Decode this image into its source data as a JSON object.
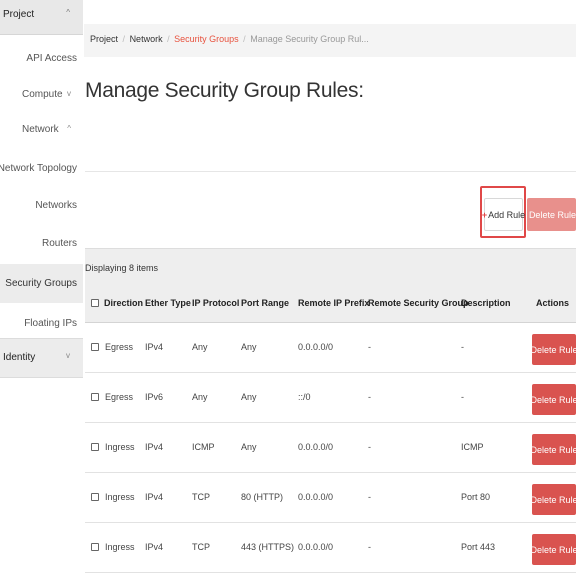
{
  "sidebar": {
    "project": {
      "label": "Project",
      "chevron": "^"
    },
    "api_access": "API Access",
    "compute": {
      "label": "Compute",
      "chevron": "v"
    },
    "network": {
      "label": "Network",
      "chevron": "^"
    },
    "network_topology": "Network Topology",
    "networks": "Networks",
    "routers": "Routers",
    "security_groups": "Security Groups",
    "floating_ips": "Floating IPs",
    "identity": {
      "label": "Identity",
      "chevron": "v"
    }
  },
  "breadcrumb": {
    "items": [
      "Project",
      "Network",
      "Security Groups",
      "Manage Security Group Rul..."
    ],
    "separator": "/"
  },
  "page_title": "Manage Security Group Rules:",
  "toolbar": {
    "add_rule_label": "Add Rule",
    "add_rule_icon": "plus-icon",
    "delete_rules_label": "Delete Rules",
    "delete_rules_icon": "trash-icon"
  },
  "table": {
    "caption": "Displaying 8 items",
    "columns": [
      "Direction",
      "Ether Type",
      "IP Protocol",
      "Port Range",
      "Remote IP Prefix",
      "Remote Security Group",
      "Description",
      "Actions"
    ],
    "rows": [
      {
        "direction": "Egress",
        "ether_type": "IPv4",
        "ip_protocol": "Any",
        "port_range": "Any",
        "remote_ip_prefix": "0.0.0.0/0",
        "remote_security_group": "-",
        "description": "-",
        "action": "Delete Rule"
      },
      {
        "direction": "Egress",
        "ether_type": "IPv6",
        "ip_protocol": "Any",
        "port_range": "Any",
        "remote_ip_prefix": "::/0",
        "remote_security_group": "-",
        "description": "-",
        "action": "Delete Rule"
      },
      {
        "direction": "Ingress",
        "ether_type": "IPv4",
        "ip_protocol": "ICMP",
        "port_range": "Any",
        "remote_ip_prefix": "0.0.0.0/0",
        "remote_security_group": "-",
        "description": "ICMP",
        "action": "Delete Rule"
      },
      {
        "direction": "Ingress",
        "ether_type": "IPv4",
        "ip_protocol": "TCP",
        "port_range": "80 (HTTP)",
        "remote_ip_prefix": "0.0.0.0/0",
        "remote_security_group": "-",
        "description": "Port 80",
        "action": "Delete Rule"
      },
      {
        "direction": "Ingress",
        "ether_type": "IPv4",
        "ip_protocol": "TCP",
        "port_range": "443 (HTTPS)",
        "remote_ip_prefix": "0.0.0.0/0",
        "remote_security_group": "-",
        "description": "Port 443",
        "action": "Delete Rule"
      }
    ]
  },
  "colors": {
    "accent": "#e8533f",
    "danger": "#d9534f",
    "danger_disabled": "#e8908c",
    "highlight_box": "#e04848"
  }
}
